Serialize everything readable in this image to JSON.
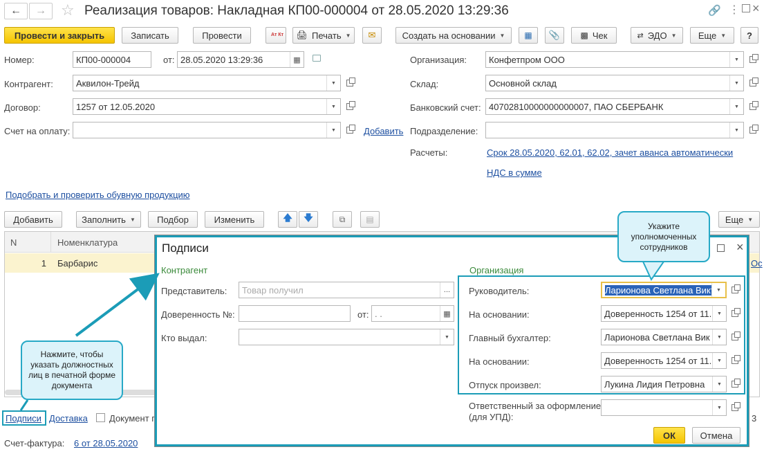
{
  "window": {
    "title": "Реализация товаров: Накладная КП00-000004 от 28.05.2020 13:29:36"
  },
  "toolbar": {
    "post_close": "Провести и закрыть",
    "save": "Записать",
    "post": "Провести",
    "dtkt": "Ат Кт",
    "print": "Печать",
    "create_based": "Создать на основании",
    "check": "Чек",
    "edo": "ЭДО",
    "more": "Еще",
    "help": "?"
  },
  "form": {
    "number_label": "Номер:",
    "number_value": "КП00-000004",
    "date_label": "от:",
    "date_value": "28.05.2020 13:29:36",
    "counterparty_label": "Контрагент:",
    "counterparty_value": "Аквилон-Трейд",
    "contract_label": "Договор:",
    "contract_value": "1257 от 12.05.2020",
    "invoice_label": "Счет на оплату:",
    "invoice_value": "",
    "add_link": "Добавить",
    "org_label": "Организация:",
    "org_value": "Конфетпром ООО",
    "warehouse_label": "Склад:",
    "warehouse_value": "Основной склад",
    "bank_label": "Банковский счет:",
    "bank_value": "40702810000000000007, ПАО СБЕРБАНК",
    "division_label": "Подразделение:",
    "division_value": "",
    "settlements_label": "Расчеты:",
    "settlements_link": "Срок 28.05.2020, 62.01, 62.02, зачет аванса автоматически",
    "vat_link": "НДС в сумме",
    "shoes_link": "Подобрать и проверить обувную продукцию"
  },
  "table_toolbar": {
    "add": "Добавить",
    "fill": "Заполнить",
    "select": "Подбор",
    "change": "Изменить",
    "more": "Еще"
  },
  "table": {
    "columns": [
      "N",
      "Номенклатура"
    ],
    "rows": [
      {
        "n": "1",
        "item": "Барбарис"
      }
    ],
    "right_edge_text": "Ос"
  },
  "bottom": {
    "signatures_link": "Подписи",
    "delivery_link": "Доставка",
    "document_checkbox_label": "Документ п",
    "invoice_label": "Счет-фактура:",
    "invoice_link": "6 от 28.05.2020",
    "right_digit": "3"
  },
  "dialog": {
    "title": "Подписи",
    "counterparty_section": "Контрагент",
    "representative_label": "Представитель:",
    "representative_placeholder": "Товар получил",
    "poa_label": "Доверенность №:",
    "poa_value": "",
    "from_label": "от:",
    "from_value": " .  .",
    "issued_by_label": "Кто выдал:",
    "issued_by_value": "",
    "org_section": "Организация",
    "head_label": "Руководитель:",
    "head_value": "Ларионова Светлана Викт",
    "basis1_label": "На основании:",
    "basis1_value": "Доверенность 1254 от 11.",
    "chief_acc_label": "Главный бухгалтер:",
    "chief_acc_value": "Ларионова Светлана Вик",
    "basis2_label": "На основании:",
    "basis2_value": "Доверенность 1254 от 11.",
    "released_label": "Отпуск произвел:",
    "released_value": "Лукина Лидия Петровна",
    "responsible_label_1": "Ответственный за оформление",
    "responsible_label_2": "(для УПД):",
    "responsible_value": "",
    "ok": "ОК",
    "cancel": "Отмена"
  },
  "callouts": {
    "top": "Укажите уполномоченных сотрудников",
    "left": "Нажмите, чтобы указать должностных лиц в печатной форме документа"
  },
  "colors": {
    "accent_yellow": "#f5c400",
    "link_blue": "#1d4fa0",
    "callout_border": "#27a9c6",
    "callout_fill": "#dcf3fa",
    "section_green": "#3a8a3a",
    "selected_row": "#fbf3cf"
  }
}
